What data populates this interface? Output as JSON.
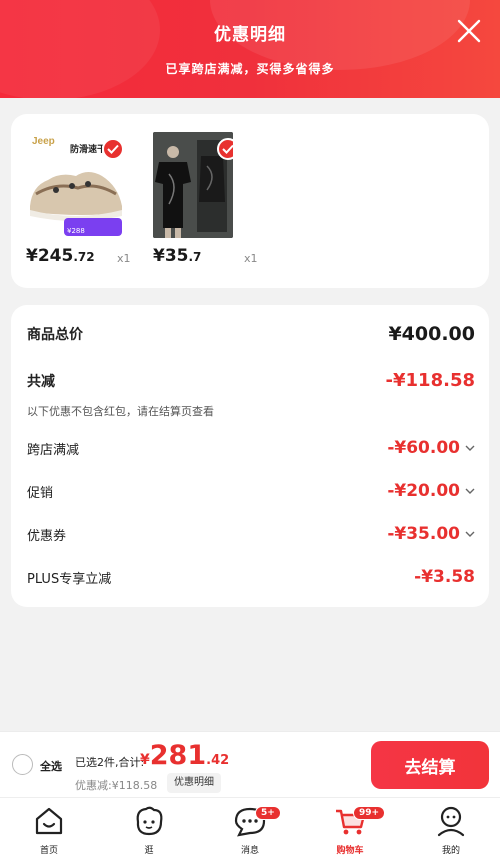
{
  "header": {
    "title": "优惠明细",
    "subtitle": "已享跨店满减，买得多省得多"
  },
  "products": [
    {
      "brand": "Jeep",
      "image_text": "防滑速干",
      "tag": "¥288",
      "price_int": "¥245",
      "price_dec": ".72",
      "qty": "x1",
      "checked": true,
      "icon": "shoe-image"
    },
    {
      "price_int": "¥35",
      "price_dec": ".7",
      "qty": "x1",
      "checked": true,
      "icon": "tshirt-image"
    }
  ],
  "summary": {
    "total_label": "商品总价",
    "total_value": "¥400.00",
    "reduce_label": "共减",
    "reduce_value": "-¥118.58",
    "note": "以下优惠不包含红包，请在结算页查看",
    "items": [
      {
        "label": "跨店满减",
        "value": "-¥60.00",
        "expandable": true
      },
      {
        "label": "促销",
        "value": "-¥20.00",
        "expandable": true
      },
      {
        "label": "优惠券",
        "value": "-¥35.00",
        "expandable": true
      },
      {
        "label": "PLUS专享立减",
        "value": "-¥3.58",
        "expandable": false
      }
    ]
  },
  "checkout": {
    "select_all": "全选",
    "selected_text": "已选2件,合计:",
    "total_cur": "¥",
    "total_int": "281",
    "total_dec": ".42",
    "discount_text": "优惠减:¥118.58",
    "detail_btn": "优惠明细",
    "pay_btn": "去结算"
  },
  "tabbar": [
    {
      "label": "首页",
      "icon": "home-icon"
    },
    {
      "label": "逛",
      "icon": "explore-face-icon"
    },
    {
      "label": "消息",
      "icon": "message-icon",
      "badge": "5+"
    },
    {
      "label": "购物车",
      "icon": "cart-icon",
      "badge": "99+",
      "active": true
    },
    {
      "label": "我的",
      "icon": "profile-icon"
    }
  ],
  "colors": {
    "accent": "#e8302f",
    "header": "#f52a3a"
  }
}
